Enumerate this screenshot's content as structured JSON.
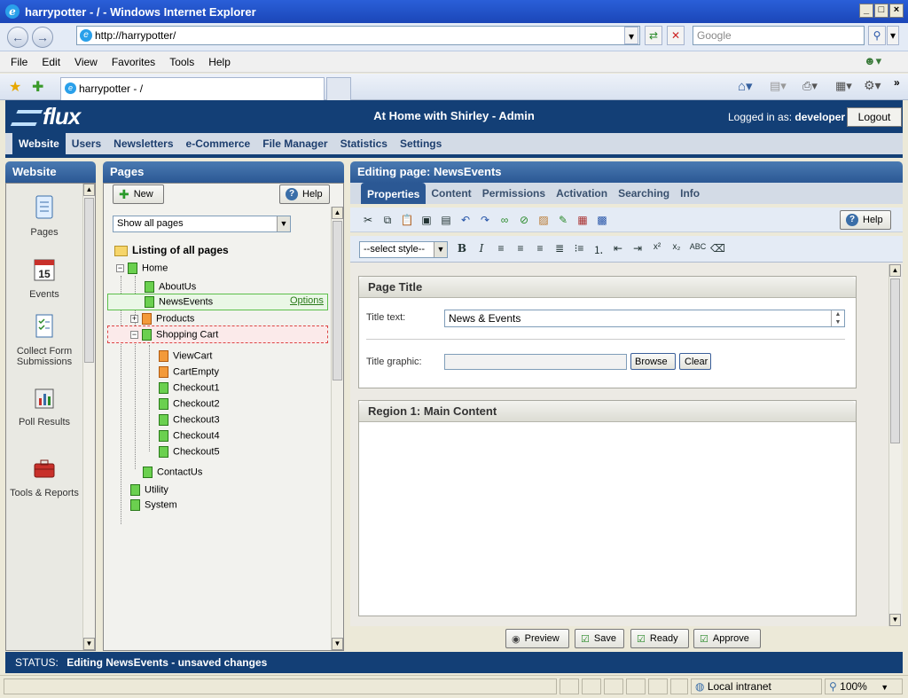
{
  "browser": {
    "title": "harrypotter - / - Windows Internet Explorer",
    "url": "http://harrypotter/",
    "search_placeholder": "Google",
    "menu": [
      "File",
      "Edit",
      "View",
      "Favorites",
      "Tools",
      "Help"
    ],
    "tab_title": "harrypotter - /",
    "status_zone": "Local intranet",
    "zoom": "100%"
  },
  "app": {
    "logo": "flux",
    "title": "At Home with Shirley - Admin",
    "logged_in_label": "Logged in as:",
    "user": "developer",
    "logout": "Logout",
    "nav": [
      "Website",
      "Users",
      "Newsletters",
      "e-Commerce",
      "File Manager",
      "Statistics",
      "Settings"
    ],
    "active_nav": "Website"
  },
  "left_panel": {
    "title": "Website",
    "items": [
      "Pages",
      "Events",
      "Collect Form Submissions",
      "Poll Results",
      "Tools & Reports"
    ]
  },
  "pages_panel": {
    "title": "Pages",
    "new_label": "New",
    "help_label": "Help",
    "filter_selected": "Show all pages",
    "listing_label": "Listing of all pages",
    "tree": {
      "home": "Home",
      "aboutus": "AboutUs",
      "newsevents": "NewsEvents",
      "options": "Options",
      "products": "Products",
      "shoppingcart": "Shopping Cart",
      "viewcart": "ViewCart",
      "cartempty": "CartEmpty",
      "checkout1": "Checkout1",
      "checkout2": "Checkout2",
      "checkout3": "Checkout3",
      "checkout4": "Checkout4",
      "checkout5": "Checkout5",
      "contactus": "ContactUs",
      "utility": "Utility",
      "system": "System"
    }
  },
  "editor": {
    "title": "Editing page: NewsEvents",
    "tabs": [
      "Properties",
      "Content",
      "Permissions",
      "Activation",
      "Searching",
      "Info"
    ],
    "help_label": "Help",
    "style_select": "--select style--",
    "page_title_box": "Page Title",
    "title_text_label": "Title text:",
    "title_text_value": "News & Events",
    "title_graphic_label": "Title graphic:",
    "browse": "Browse",
    "clear": "Clear",
    "region_box": "Region 1: Main Content",
    "actions": [
      "Preview",
      "Save",
      "Ready",
      "Approve"
    ]
  },
  "status": {
    "label": "STATUS:",
    "text": "Editing NewsEvents - unsaved changes"
  },
  "colors": {
    "header_blue": "#133f76",
    "panel_header": "#2b5894",
    "page_icon_green": "#6bd04f",
    "page_icon_orange": "#f39a3a"
  }
}
